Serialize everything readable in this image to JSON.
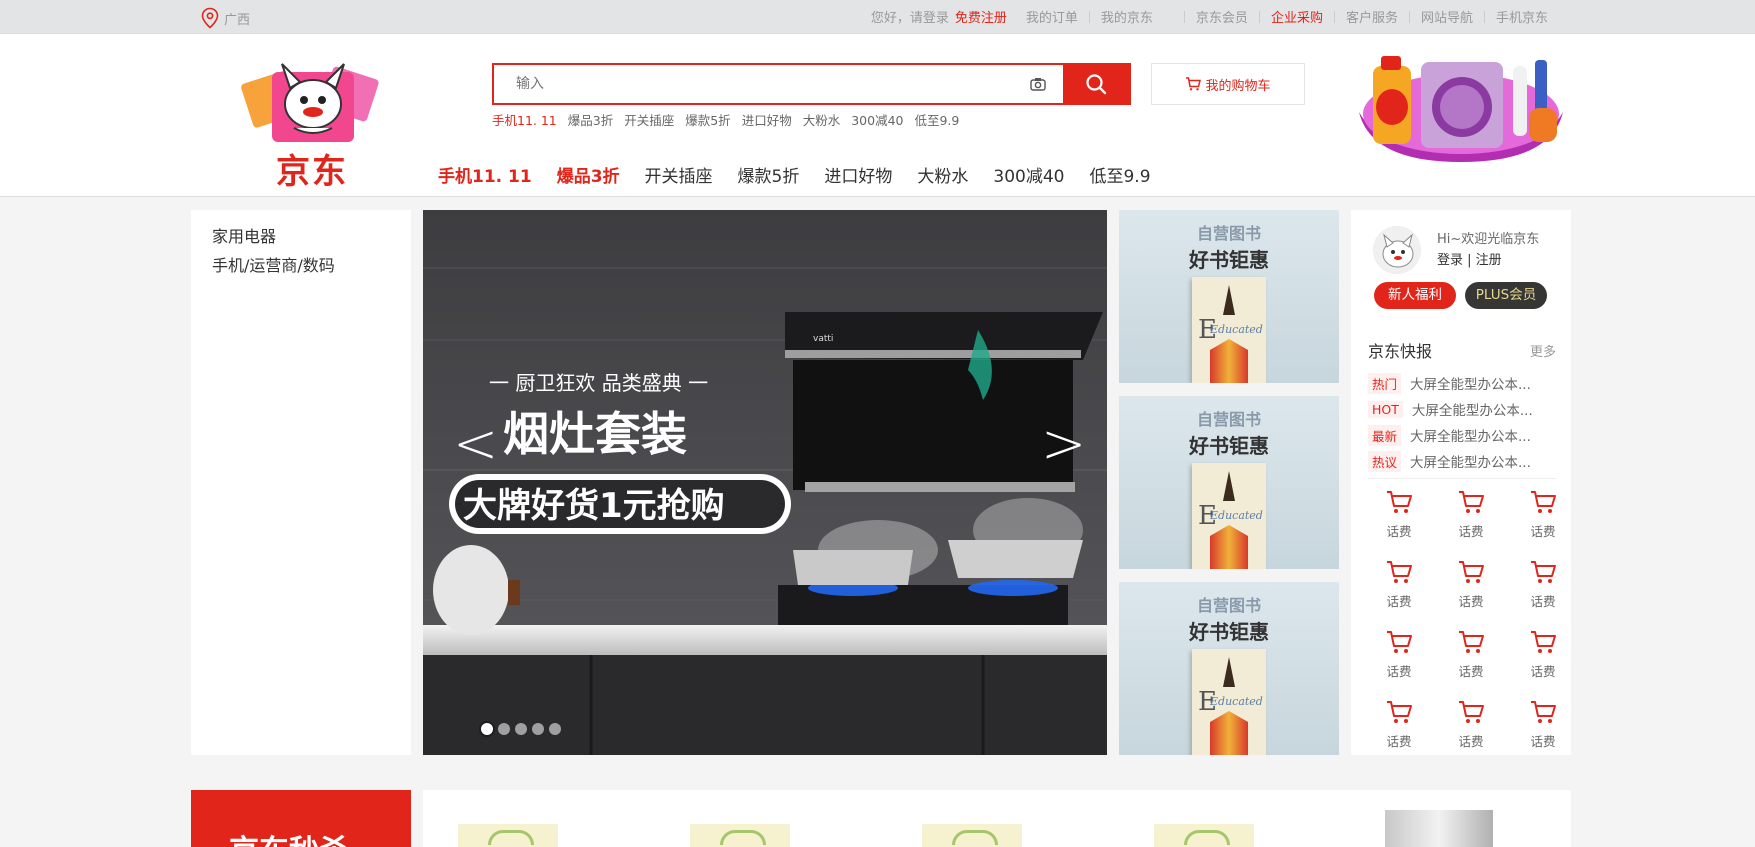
{
  "topbar": {
    "location": "广西",
    "greeting": "您好，请登录",
    "register": "免费注册",
    "links": [
      "我的订单",
      "我的京东",
      "京东会员",
      "企业采购",
      "客户服务",
      "网站导航",
      "手机京东"
    ]
  },
  "header": {
    "logo_text": "京东",
    "search_placeholder": "输入",
    "cart_label": "我的购物车",
    "hotwords": [
      "手机11. 11",
      "爆品3折",
      "开关插座",
      "爆款5折",
      "进口好物",
      "大粉水",
      "300减40",
      "低至9.9"
    ],
    "nav": [
      "手机11. 11",
      "爆品3折",
      "开关插座",
      "爆款5折",
      "进口好物",
      "大粉水",
      "300减40",
      "低至9.9"
    ]
  },
  "categories": [
    "家用电器",
    "手机/运营商/数码"
  ],
  "banner": {
    "brand": "vatti",
    "line1": "一 厨卫狂欢   品类盛典 一",
    "line2": "烟灶套装",
    "line3": "大牌好货1元抢购",
    "prev": "<",
    "next": ">",
    "dots": 5,
    "active_dot": 0
  },
  "books": [
    {
      "title": "自营图书",
      "subtitle": "好书钜惠",
      "cover_word": "Educated"
    },
    {
      "title": "自营图书",
      "subtitle": "好书钜惠",
      "cover_word": "Educated"
    },
    {
      "title": "自营图书",
      "subtitle": "好书钜惠",
      "cover_word": "Educated"
    }
  ],
  "user": {
    "welcome": "Hi~欢迎光临京东",
    "login": "登录",
    "divider": " | ",
    "register": "注册",
    "new_user_btn": "新人福利",
    "plus_btn": "PLUS会员"
  },
  "news": {
    "title": "京东快报",
    "more": "更多",
    "items": [
      {
        "tag": "热门",
        "text": "大屏全能型办公本..."
      },
      {
        "tag": "HOT",
        "text": "大屏全能型办公本..."
      },
      {
        "tag": "最新",
        "text": "大屏全能型办公本..."
      },
      {
        "tag": "热议",
        "text": "大屏全能型办公本..."
      }
    ]
  },
  "services": [
    "话费",
    "话费",
    "话费",
    "话费",
    "话费",
    "话费",
    "话费",
    "话费",
    "话费",
    "话费",
    "话费",
    "话费"
  ],
  "seckill": {
    "title": "京东秒杀"
  },
  "colors": {
    "accent": "#e1251b",
    "plus_bg": "#363634",
    "plus_text": "#e5d790"
  }
}
